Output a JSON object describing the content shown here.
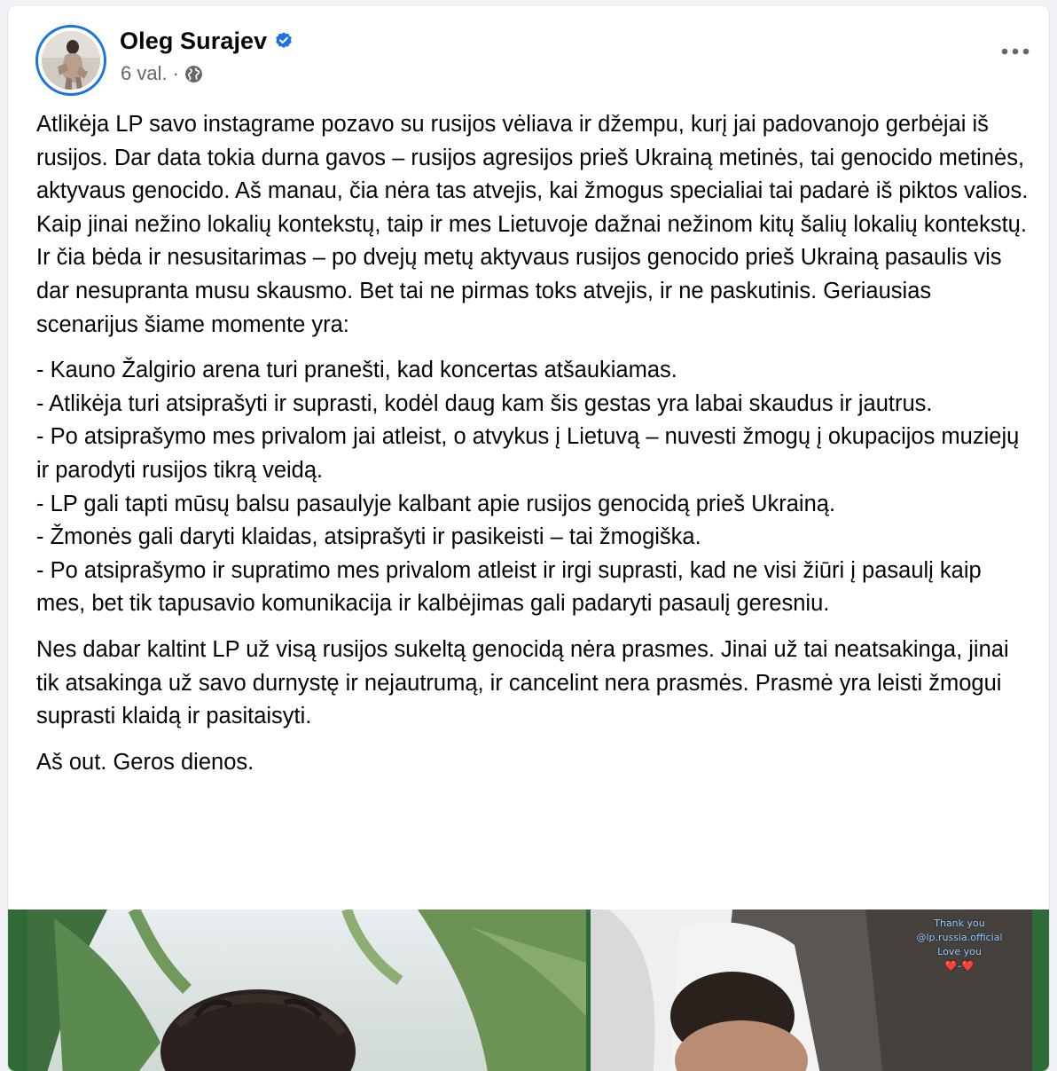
{
  "post": {
    "author": "Oleg Surajev",
    "time": "6 val.",
    "separator": "·",
    "icons": {
      "verified": "verified-badge-icon",
      "audience": "globe-icon",
      "more": "more-horizontal-icon"
    },
    "colors": {
      "verified": "#1b74e4",
      "text": "#050505",
      "secondary": "#65676b"
    },
    "paragraphs": [
      "Atlikėja LP savo instagrame pozavo su rusijos vėliava ir džempu, kurį jai padovanojo gerbėjai iš rusijos. Dar data tokia durna gavos – rusijos agresijos prieš Ukrainą metinės, tai genocido metinės, aktyvaus genocido. Aš manau, čia nėra tas atvejis, kai žmogus specialiai tai padarė iš piktos valios. Kaip jinai nežino lokalių kontekstų, taip ir mes Lietuvoje dažnai nežinom kitų šalių lokalių kontekstų. Ir čia bėda ir nesusitarimas – po dvejų metų aktyvaus rusijos genocido prieš Ukrainą pasaulis vis dar nesupranta musu skausmo. Bet tai ne pirmas toks atvejis, ir ne paskutinis. Geriausias scenarijus šiame momente yra:",
      "- Kauno Žalgirio arena turi pranešti, kad koncertas atšaukiamas.\n- Atlikėja turi atsiprašyti ir suprasti, kodėl daug kam šis gestas yra labai skaudus ir jautrus.\n- Po atsiprašymo mes privalom jai atleist, o atvykus į Lietuvą – nuvesti žmogų į okupacijos muziejų ir parodyti rusijos tikrą veidą.\n- LP gali tapti mūsų balsu pasaulyje kalbant apie rusijos genocidą prieš Ukrainą.\n- Žmonės gali daryti klaidas, atsiprašyti ir pasikeisti – tai žmogiška.\n- Po atsiprašymo ir supratimo mes privalom atleist ir irgi suprasti, kad ne visi žiūri į pasaulį kaip mes, bet tik tapusavio komunikacija ir kalbėjimas gali padaryti pasaulį geresniu.",
      "Nes dabar kaltint LP už visą rusijos sukeltą genocidą nėra prasmes. Jinai už tai neatsakinga, jinai tik atsakinga už savo durnystę ir nejautrumą, ir cancelint nera prasmės. Prasmė yra leisti žmogui suprasti klaidą ir pasitaisyti.",
      "Aš out. Geros dienos."
    ],
    "media": {
      "story_caption": [
        "Thank you",
        "@lp.russia.official",
        "Love you",
        "❤️–❤️"
      ]
    }
  }
}
